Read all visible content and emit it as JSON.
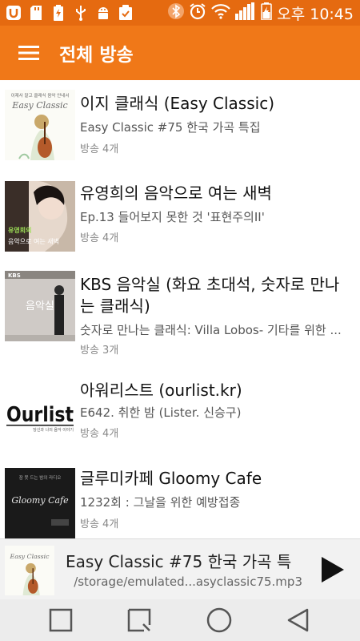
{
  "status_bar": {
    "time_label": "오후 10:45",
    "left_icons": [
      "app-notification-icon",
      "sd-card-icon",
      "battery-saver-icon",
      "usb-icon",
      "android-debug-icon",
      "download-complete-icon"
    ],
    "right_icons": [
      "bluetooth-icon",
      "alarm-icon",
      "wifi-icon",
      "signal-icon",
      "battery-charging-icon"
    ]
  },
  "app_bar": {
    "title": "전체 방송"
  },
  "podcasts": [
    {
      "title": "이지 클래식 (Easy Classic)",
      "subtitle": "Easy Classic #75 한국 가곡 특집",
      "count": "방송 4개"
    },
    {
      "title": "유영희의 음악으로 여는 새벽",
      "subtitle": "Ep.13 들어보지 못한 것 '표현주의II'",
      "count": "방송 4개"
    },
    {
      "title": "KBS 음악실 (화요 초대석, 숫자로 만나는 클래식)",
      "subtitle": "숫자로 만나는 클래식: Villa Lobos- 기타를 위한 ...",
      "count": "방송 3개"
    },
    {
      "title": "아워리스트 (ourlist.kr)",
      "subtitle": "E642. 취한 밤 (Lister. 신승구)",
      "count": "방송 4개"
    },
    {
      "title": "글루미카페 Gloomy Cafe",
      "subtitle": "1232회 : 그날을 위한 예방접종",
      "count": "방송 4개"
    }
  ],
  "thumb_text": {
    "easy_small": "이제사 말고 클래식 음악 안내서",
    "easy_logo": "Easy Classic",
    "yoo_line1": "유영희의",
    "yoo_line2": "음악으로 여는 새벽",
    "kbs_logo": "KBS",
    "kbs_name": "음악실",
    "ourlist_logo": "Ourlist",
    "ourlist_tag": "당신과 나의 음악 이야기",
    "gloomy_small": "잠 못 드는 밤의 라디오",
    "gloomy_logo": "Gloomy Cafe"
  },
  "player": {
    "title": "Easy Classic #75 한국 가곡 특",
    "path": "/storage/emulated...asyclassic75.mp3",
    "play_icon": "play-icon"
  },
  "nav_bar": {
    "icons": [
      "recent-apps-icon",
      "capture-icon",
      "home-icon",
      "back-icon"
    ]
  },
  "colors": {
    "status": "#e56a10",
    "appbar": "#f07818",
    "player_bg": "#f2f2f2",
    "nav_bg": "#ececec"
  }
}
